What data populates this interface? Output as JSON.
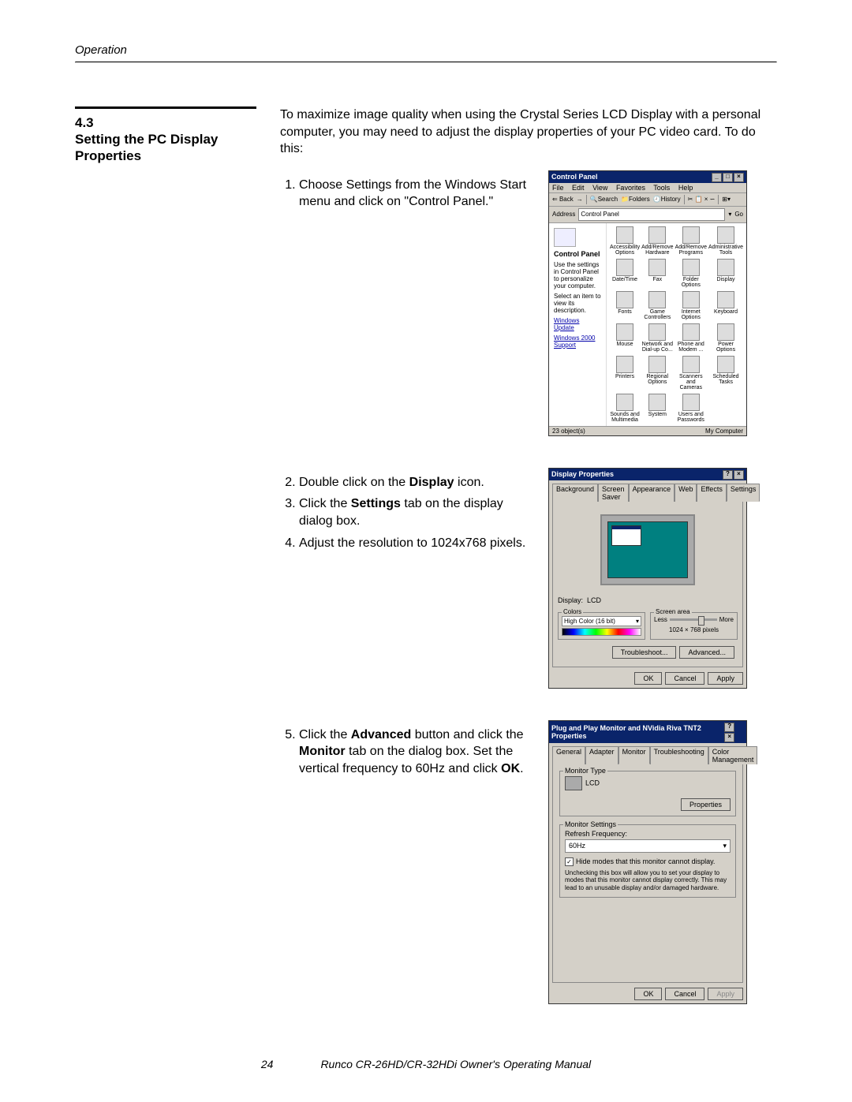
{
  "header": {
    "section_label": "Operation"
  },
  "section": {
    "number": "4.3",
    "title": "Setting the PC Display Properties"
  },
  "intro": "To maximize image quality when using the Crystal Series LCD Display with a personal computer, you may need to adjust the display properties of your PC video card. To do this:",
  "steps": {
    "s1": "Choose Settings from the Windows Start menu and click on \"Control Panel.\"",
    "s2_pre": "Double click on the ",
    "s2_bold": "Display",
    "s2_post": " icon.",
    "s3_pre": "Click the ",
    "s3_bold": "Settings",
    "s3_post": " tab on the display dialog box.",
    "s4": "Adjust the resolution to 1024x768 pixels.",
    "s5_pre": "Click the ",
    "s5_b1": "Advanced",
    "s5_mid": " button and click the ",
    "s5_b2": "Monitor",
    "s5_mid2": " tab on the dialog box. Set the vertical frequency to 60Hz and click ",
    "s5_b3": "OK",
    "s5_post": "."
  },
  "control_panel": {
    "title": "Control Panel",
    "menu": [
      "File",
      "Edit",
      "View",
      "Favorites",
      "Tools",
      "Help"
    ],
    "toolbar": {
      "back": "Back",
      "search": "Search",
      "folders": "Folders",
      "history": "History"
    },
    "address_label": "Address",
    "address_value": "Control Panel",
    "go": "Go",
    "side_title": "Control Panel",
    "side_text": "Use the settings in Control Panel to personalize your computer.",
    "side_hint": "Select an item to view its description.",
    "links": [
      "Windows Update",
      "Windows 2000 Support"
    ],
    "icons": [
      "Accessibility Options",
      "Add/Remove Hardware",
      "Add/Remove Programs",
      "Administrative Tools",
      "Date/Time",
      "Fax",
      "Folder Options",
      "Display",
      "Fonts",
      "Game Controllers",
      "Internet Options",
      "Keyboard",
      "Mouse",
      "Network and Dial-up Co...",
      "Phone and Modem ...",
      "Power Options",
      "Printers",
      "Regional Options",
      "Scanners and Cameras",
      "Scheduled Tasks",
      "Sounds and Multimedia",
      "System",
      "Users and Passwords"
    ],
    "status_left": "23 object(s)",
    "status_right": "My Computer"
  },
  "display_props": {
    "title": "Display Properties",
    "tabs": [
      "Background",
      "Screen Saver",
      "Appearance",
      "Web",
      "Effects",
      "Settings"
    ],
    "display_label": "Display:",
    "display_value": "LCD",
    "colors_legend": "Colors",
    "color_depth": "High Color (16 bit)",
    "area_legend": "Screen area",
    "less": "Less",
    "more": "More",
    "resolution": "1024 × 768 pixels",
    "troubleshoot": "Troubleshoot...",
    "advanced": "Advanced...",
    "ok": "OK",
    "cancel": "Cancel",
    "apply": "Apply"
  },
  "monitor_props": {
    "title": "Plug and Play Monitor and NVidia Riva TNT2 Properties",
    "tabs": [
      "General",
      "Adapter",
      "Monitor",
      "Troubleshooting",
      "Color Management"
    ],
    "type_legend": "Monitor Type",
    "type_value": "LCD",
    "properties": "Properties",
    "settings_legend": "Monitor Settings",
    "refresh_label": "Refresh Frequency:",
    "refresh_value": "60Hz",
    "hide_check": "Hide modes that this monitor cannot display.",
    "hide_text": "Unchecking this box will allow you to set your display to modes that this monitor cannot display correctly. This may lead to an unusable display and/or damaged hardware.",
    "ok": "OK",
    "cancel": "Cancel",
    "apply": "Apply"
  },
  "footer": {
    "page": "24",
    "manual": "Runco CR-26HD/CR-32HDi Owner's Operating Manual"
  }
}
